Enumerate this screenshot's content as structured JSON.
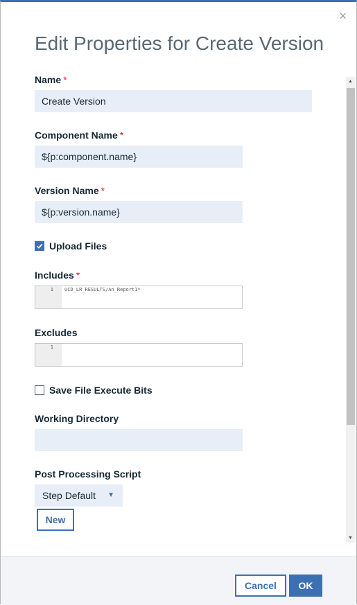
{
  "dialog": {
    "title": "Edit Properties for Create Version",
    "close_symbol": "×"
  },
  "required_marker": "*",
  "fields": {
    "name": {
      "label": "Name",
      "value": "Create Version"
    },
    "component_name": {
      "label": "Component Name",
      "value": "${p:component.name}"
    },
    "version_name": {
      "label": "Version Name",
      "value": "${p:version.name}"
    },
    "upload_files": {
      "label": "Upload Files",
      "checked": true
    },
    "includes": {
      "label": "Includes",
      "line_number": "1",
      "code": "UCD_LR_RESULTS/An_Report1*"
    },
    "excludes": {
      "label": "Excludes",
      "line_number": "1",
      "code": ""
    },
    "save_file_execute_bits": {
      "label": "Save File Execute Bits",
      "checked": false
    },
    "working_directory": {
      "label": "Working Directory",
      "value": ""
    },
    "post_processing_script": {
      "label": "Post Processing Script",
      "selected": "Step Default",
      "new_button": "New"
    }
  },
  "footer": {
    "cancel_label": "Cancel",
    "ok_label": "OK"
  },
  "icons": {
    "close": "close-icon",
    "checkmark": "checkmark-icon",
    "dropdown": "chevron-down-icon"
  },
  "colors": {
    "accent": "#3d70b2",
    "required": "#e0182d",
    "input_bg": "#e8eef7",
    "footer_bg": "#f2f4f8"
  }
}
